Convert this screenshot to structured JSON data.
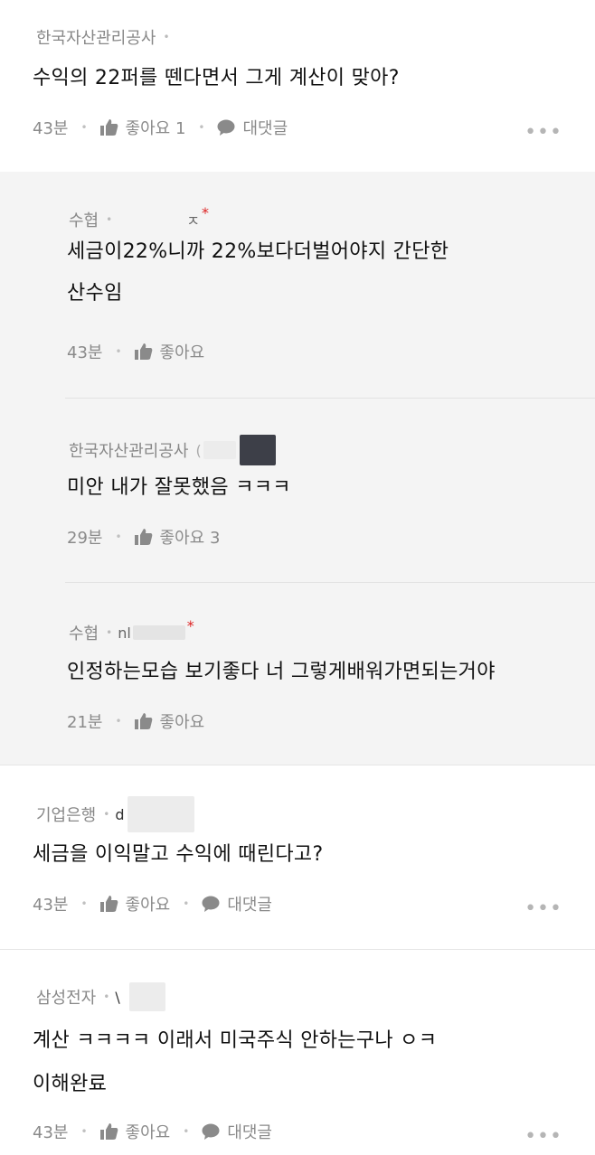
{
  "comments": [
    {
      "author": "한국자산관리공사",
      "text": "수익의 22퍼를 뗀다면서 그게 계산이 맞아?",
      "time": "43분",
      "like_label": "좋아요 1",
      "reply_label": "대댓글",
      "more": "•••"
    },
    {
      "author": "기업은행",
      "nick": "d",
      "text": "세금을 이익말고 수익에 때린다고?",
      "time": "43분",
      "like_label": "좋아요",
      "reply_label": "대댓글",
      "more": "•••"
    },
    {
      "author": "삼성전자",
      "nick": "\\",
      "text_line1": "계산 ㅋㅋㅋㅋ 이래서 미국주식 안하는구나 ㅇㅋ",
      "text_line2": "이해완료",
      "time": "43분",
      "like_label": "좋아요",
      "reply_label": "대댓글",
      "more": "•••"
    }
  ],
  "replies": [
    {
      "author": "수협",
      "nick": "ㅈ",
      "star": "*",
      "text_line1": "세금이22%니까 22%보다더벌어야지 간단한",
      "text_line2": "산수임",
      "time": "43분",
      "like_label": "좋아요"
    },
    {
      "author": "한국자산관리공사",
      "nick": "(",
      "text": "미안 내가 잘못했음 ㅋㅋㅋ",
      "time": "29분",
      "like_label": "좋아요 3"
    },
    {
      "author": "수협",
      "nick": "nl",
      "star": "*",
      "text": "인정하는모습 보기좋다 너 그렇게배워가면되는거야",
      "time": "21분",
      "like_label": "좋아요"
    }
  ]
}
